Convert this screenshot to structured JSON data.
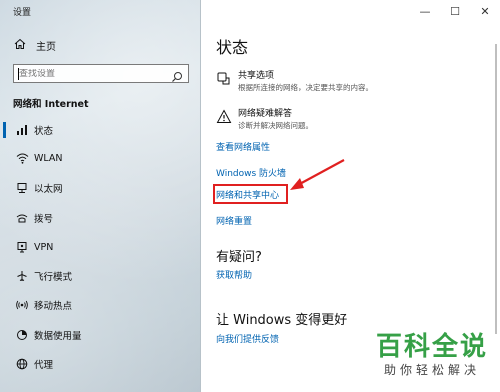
{
  "window": {
    "title": "设置",
    "minimize": "—",
    "maximize": "☐",
    "close": "✕"
  },
  "sidebar": {
    "home_label": "主页",
    "search_placeholder": "查找设置",
    "section_title": "网络和 Internet",
    "items": [
      {
        "label": "状态",
        "icon": "status-icon",
        "active": true
      },
      {
        "label": "WLAN",
        "icon": "wifi-icon"
      },
      {
        "label": "以太网",
        "icon": "ethernet-icon"
      },
      {
        "label": "拨号",
        "icon": "dialup-icon"
      },
      {
        "label": "VPN",
        "icon": "vpn-icon"
      },
      {
        "label": "飞行模式",
        "icon": "airplane-icon"
      },
      {
        "label": "移动热点",
        "icon": "hotspot-icon"
      },
      {
        "label": "数据使用量",
        "icon": "data-usage-icon"
      },
      {
        "label": "代理",
        "icon": "globe-icon"
      }
    ]
  },
  "main": {
    "title": "状态",
    "options": [
      {
        "title": "共享选项",
        "desc": "根据所连接的网络，决定要共享的内容。",
        "icon": "share-icon"
      },
      {
        "title": "网络疑难解答",
        "desc": "诊断并解决网络问题。",
        "icon": "troubleshoot-icon"
      }
    ],
    "links": {
      "network_properties": "查看网络属性",
      "firewall": "Windows 防火墙",
      "sharing_center": "网络和共享中心",
      "network_reset": "网络重置"
    },
    "help_heading": "有疑问?",
    "help_link": "获取帮助",
    "improve_heading": "让 Windows 变得更好",
    "feedback_link": "向我们提供反馈"
  },
  "watermark": {
    "line1": "百科全说",
    "line2": "助你轻松解决"
  },
  "colors": {
    "accent": "#0063b1",
    "highlight": "#e02020",
    "watermark": "#36a047"
  }
}
